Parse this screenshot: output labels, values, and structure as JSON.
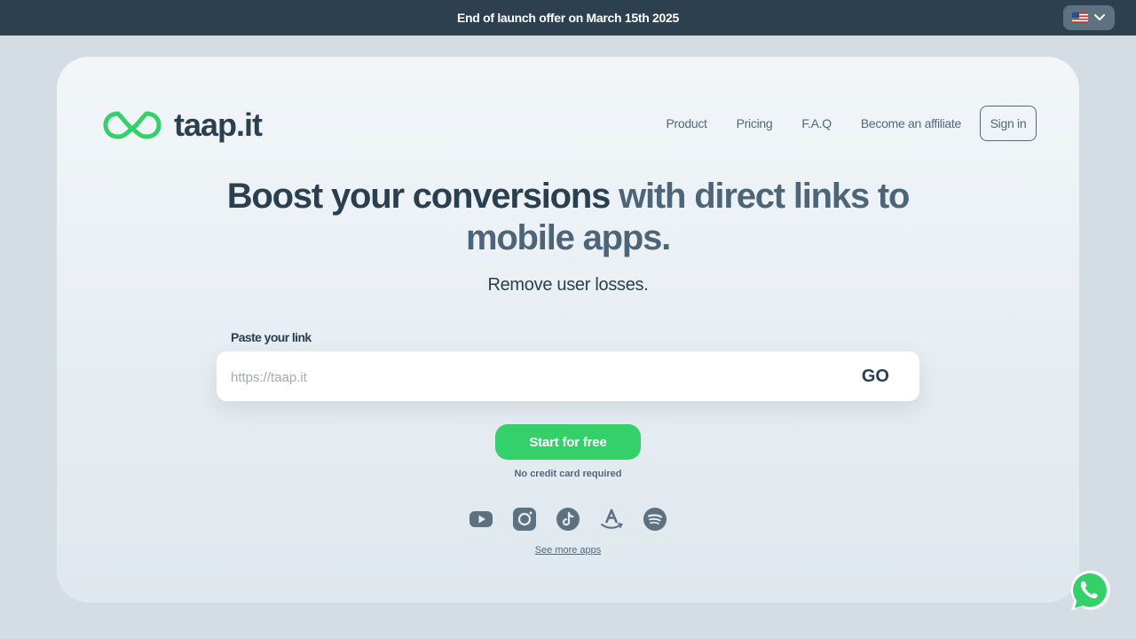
{
  "topbar": {
    "announcement": "End of launch offer on March 15th 2025",
    "language": {
      "flag_icon": "us-flag-icon",
      "dropdown_icon": "chevron-down-icon"
    }
  },
  "header": {
    "logo_text": "taap.it",
    "nav": {
      "product": "Product",
      "pricing": "Pricing",
      "faq": "F.A.Q",
      "affiliate": "Become an affiliate",
      "signin": "Sign in"
    }
  },
  "hero": {
    "title_part1": "Boost your conversions ",
    "title_part2": "with direct links to mobile apps.",
    "subtitle": "Remove user losses."
  },
  "link_form": {
    "label": "Paste your link",
    "placeholder": "https://taap.it",
    "value": "",
    "submit_label": "GO"
  },
  "cta": {
    "start_label": "Start for free",
    "note": "No credit card required"
  },
  "apps": {
    "icons": [
      "youtube-icon",
      "instagram-icon",
      "tiktok-icon",
      "amazon-icon",
      "spotify-icon"
    ],
    "see_more": "See more apps"
  },
  "colors": {
    "topbar_bg": "#2c4050",
    "accent_green": "#34d06a",
    "text_dark": "#2a3f4f",
    "text_muted": "#51687a",
    "icon_gray": "#5d7181",
    "page_bg": "#d3dde3"
  }
}
